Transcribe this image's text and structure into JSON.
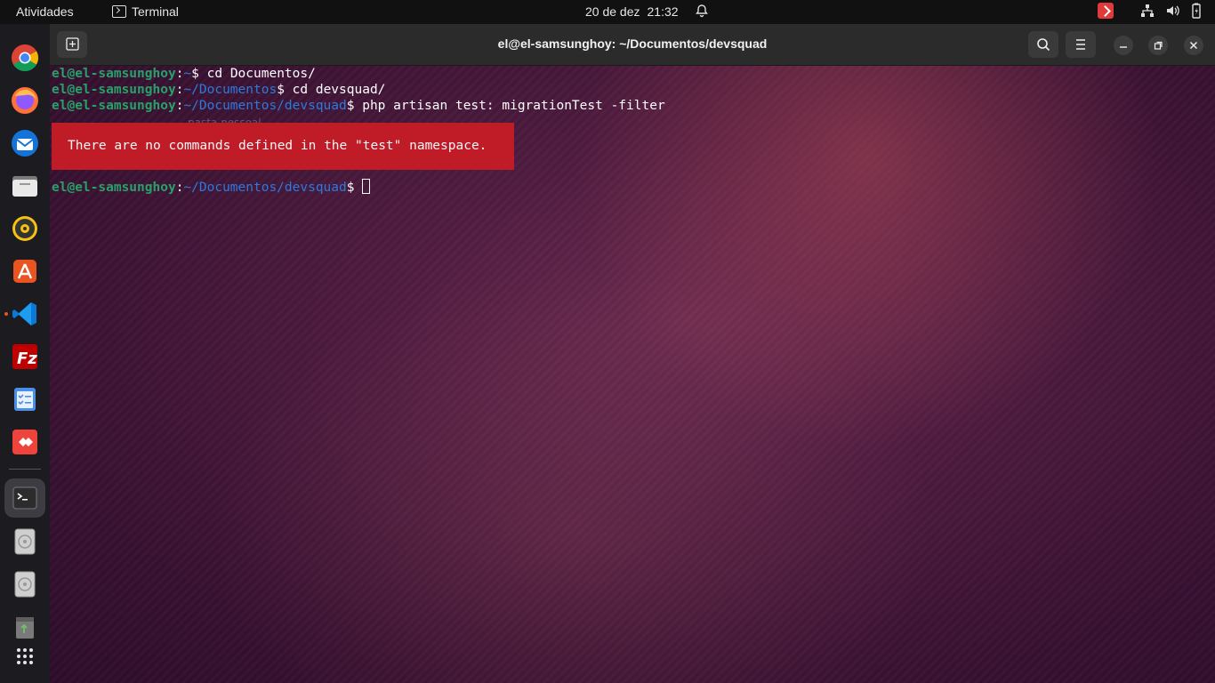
{
  "topbar": {
    "activities": "Atividades",
    "app_name": "Terminal",
    "date": "20 de dez",
    "time": "21:32"
  },
  "dock": {
    "items": [
      {
        "name": "chrome-icon"
      },
      {
        "name": "firefox-icon"
      },
      {
        "name": "thunderbird-icon"
      },
      {
        "name": "files-icon"
      },
      {
        "name": "rhythmbox-icon"
      },
      {
        "name": "app-center-icon"
      },
      {
        "name": "vscode-icon"
      },
      {
        "name": "filezilla-icon"
      },
      {
        "name": "tasks-icon"
      },
      {
        "name": "anydesk-icon"
      },
      {
        "name": "terminal-icon"
      },
      {
        "name": "disk-icon"
      },
      {
        "name": "disk-icon-2"
      },
      {
        "name": "trash-icon"
      },
      {
        "name": "show-apps-icon"
      }
    ]
  },
  "window": {
    "title": "el@el-samsunghoy: ~/Documentos/devsquad"
  },
  "terminal": {
    "lines": [
      {
        "user": "el@el-samsunghoy",
        "sep": ":",
        "path": "~",
        "prompt": "$ ",
        "cmd": "cd Documentos/"
      },
      {
        "user": "el@el-samsunghoy",
        "sep": ":",
        "path": "~/Documentos",
        "prompt": "$ ",
        "cmd": "cd devsquad/"
      },
      {
        "user": "el@el-samsunghoy",
        "sep": ":",
        "path": "~/Documentos/devsquad",
        "prompt": "$ ",
        "cmd": "php artisan test: migrationTest -filter"
      }
    ],
    "error": "There are no commands defined in the \"test\" namespace.",
    "final_prompt": {
      "user": "el@el-samsunghoy",
      "sep": ":",
      "path": "~/Documentos/devsquad",
      "prompt": "$ "
    },
    "ghost_text": "pasta pessoal"
  },
  "colors": {
    "user": "#26a269",
    "path": "#2a7bde",
    "error_bg": "#c01c28"
  }
}
